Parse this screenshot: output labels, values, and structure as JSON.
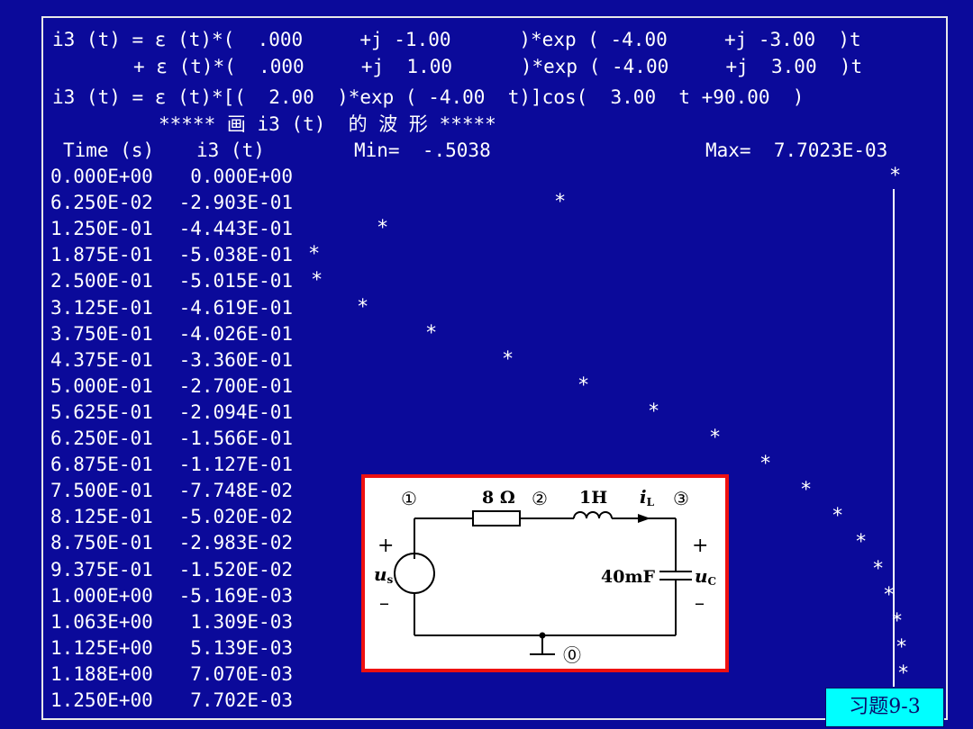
{
  "header": {
    "eq1a": "i3 (t) = ε (t)*(  .000     +j -1.00      )*exp ( -4.00     +j -3.00  )t",
    "eq1b": "+ ε (t)*(  .000     +j  1.00      )*exp ( -4.00     +j  3.00  )t",
    "eq2": "i3 (t) = ε (t)*[(  2.00  )*exp ( -4.00  t)]cos(  3.00  t +90.00  )",
    "plot_title": "***** 画 i3 (t)  的 波 形 *****",
    "col_time": "Time (s)",
    "col_i3": "i3 (t)",
    "min_label": "Min=  -.5038",
    "max_label": "Max=  7.7023E-03"
  },
  "table": {
    "rows": [
      {
        "time": "0.000E+00",
        "value": "0.000E+00",
        "v": 0.0
      },
      {
        "time": "6.250E-02",
        "value": "-2.903E-01",
        "v": -0.2903
      },
      {
        "time": "1.250E-01",
        "value": "-4.443E-01",
        "v": -0.4443
      },
      {
        "time": "1.875E-01",
        "value": "-5.038E-01",
        "v": -0.5038
      },
      {
        "time": "2.500E-01",
        "value": "-5.015E-01",
        "v": -0.5015
      },
      {
        "time": "3.125E-01",
        "value": "-4.619E-01",
        "v": -0.4619
      },
      {
        "time": "3.750E-01",
        "value": "-4.026E-01",
        "v": -0.4026
      },
      {
        "time": "4.375E-01",
        "value": "-3.360E-01",
        "v": -0.336
      },
      {
        "time": "5.000E-01",
        "value": "-2.700E-01",
        "v": -0.27
      },
      {
        "time": "5.625E-01",
        "value": "-2.094E-01",
        "v": -0.2094
      },
      {
        "time": "6.250E-01",
        "value": "-1.566E-01",
        "v": -0.1566
      },
      {
        "time": "6.875E-01",
        "value": "-1.127E-01",
        "v": -0.1127
      },
      {
        "time": "7.500E-01",
        "value": "-7.748E-02",
        "v": -0.07748
      },
      {
        "time": "8.125E-01",
        "value": "-5.020E-02",
        "v": -0.0502
      },
      {
        "time": "8.750E-01",
        "value": "-2.983E-02",
        "v": -0.02983
      },
      {
        "time": "9.375E-01",
        "value": "-1.520E-02",
        "v": -0.0152
      },
      {
        "time": "1.000E+00",
        "value": "-5.169E-03",
        "v": -0.005169
      },
      {
        "time": "1.063E+00",
        "value": "1.309E-03",
        "v": 0.001309
      },
      {
        "time": "1.125E+00",
        "value": "5.139E-03",
        "v": 0.005139
      },
      {
        "time": "1.188E+00",
        "value": "7.070E-03",
        "v": 0.00707
      },
      {
        "time": "1.250E+00",
        "value": "7.702E-03",
        "v": 0.007702
      }
    ],
    "marker": "*",
    "min": -0.5038,
    "max": 0.0077023
  },
  "circuit": {
    "node1": "①",
    "node2": "②",
    "node3": "③",
    "node0": "⓪",
    "resistor": "8 Ω",
    "inductor": "1H",
    "current_i": "i",
    "current_sub": "L",
    "source_u": "u",
    "source_sub": "s",
    "cap": "40mF",
    "cap_u": "u",
    "cap_sub": "C",
    "plus": "+",
    "minus": "–"
  },
  "tag_label": "习题9-3"
}
